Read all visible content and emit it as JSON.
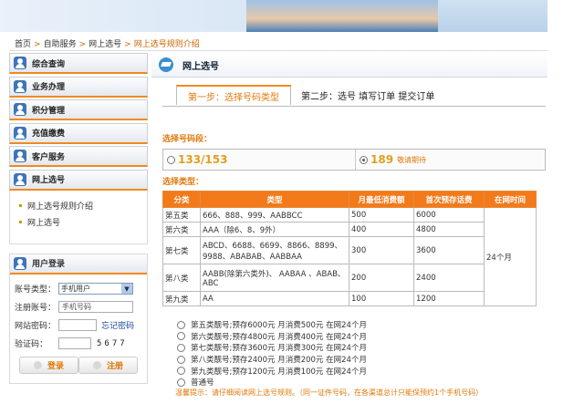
{
  "breadcrumb": {
    "items": [
      "首页",
      "自助服务",
      "网上选号"
    ],
    "separator": ">",
    "current": "网上选号规则介绍"
  },
  "sidebar": {
    "menu": [
      {
        "label": "综合查询"
      },
      {
        "label": "业务办理"
      },
      {
        "label": "积分管理"
      },
      {
        "label": "充值缴费"
      },
      {
        "label": "客户服务"
      },
      {
        "label": "网上选号"
      }
    ],
    "submenu": [
      {
        "label": "网上选号规则介绍"
      },
      {
        "label": "网上选号"
      }
    ]
  },
  "login": {
    "title": "用户登录",
    "account_type_label": "账号类型：",
    "account_type_value": "手机用户",
    "account_label": "注册账号：",
    "account_placeholder": "手机号码",
    "password_label": "网站密码：",
    "forgot_label": "忘记密码",
    "captcha_label": "验证码：",
    "captcha_text": "5677",
    "login_button": "登录",
    "register_button": "注册"
  },
  "main": {
    "title": "网上选号",
    "step1": "第一步：选择号码类型",
    "step2": "第二步：选号 填写订单 提交订单",
    "segment_heading": "选择号码段：",
    "segment_a": "133/153",
    "segment_b": "189",
    "segment_b_note": "敬请期待",
    "type_heading": "选择类型：",
    "table_headers": [
      "分类",
      "类型",
      "月最低消费额",
      "首次预存话费",
      "在网时间"
    ],
    "table_rows": [
      [
        "第五类",
        "666、888、999、AABBCC",
        "500",
        "6000"
      ],
      [
        "第六类",
        "AAA（除6、8、9外）",
        "400",
        "4800"
      ],
      [
        "第七类",
        "ABCD、6688、6699、8866、8899、9988、ABABAB、AABBAA",
        "300",
        "3600"
      ],
      [
        "第八类",
        "AABB(除第六类外)、 AABAA 、ABAB、ABC",
        "200",
        "2400"
      ],
      [
        "第九类",
        "AA",
        "100",
        "1200"
      ]
    ],
    "online_time": "24个月",
    "options": [
      "第五类靓号;预存6000元  月消费500元  在网24个月",
      "第六类靓号;预存4800元  月消费400元  在网24个月",
      "第七类靓号;预存3600元  月消费300元  在网24个月",
      "第八类靓号;预存2400元  月消费200元  在网24个月",
      "第九类靓号;预存1200元  月消费100元  在网24个月",
      "普通号"
    ],
    "tip": "温馨提示：请仔细阅读网上选号规则。（同一证件号码，在各渠道总计只能保预约1个手机号码）"
  }
}
